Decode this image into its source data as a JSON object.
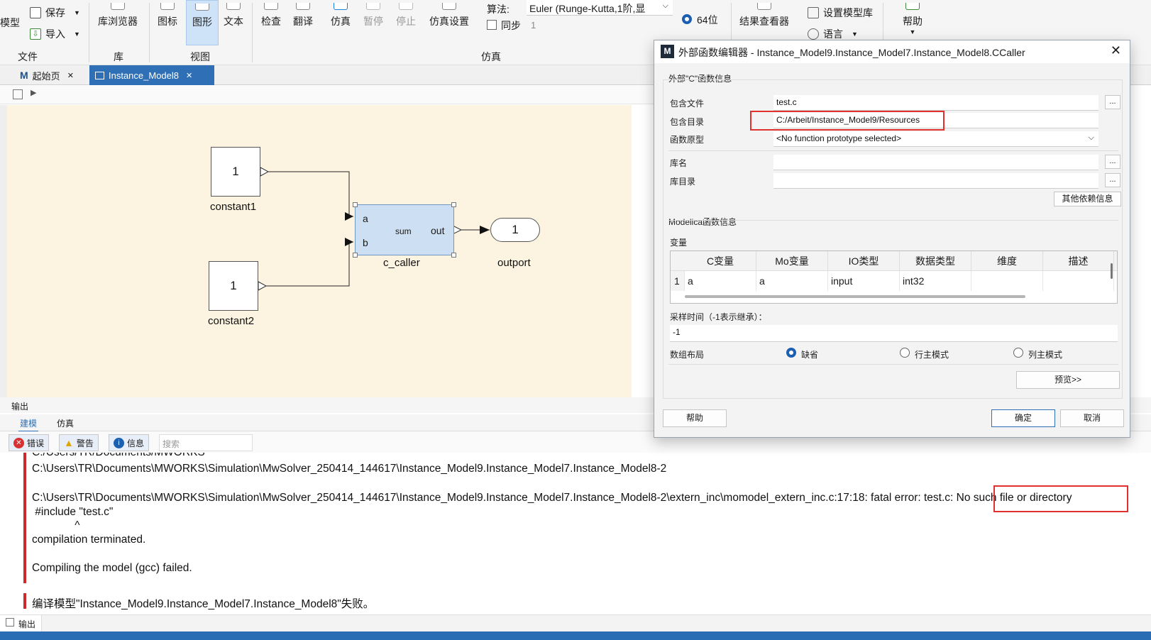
{
  "ribbon": {
    "model_label": "模型",
    "save_label": "保存",
    "import_label": "导入",
    "lib_browser_label": "库浏览器",
    "icon_label": "图标",
    "diagram_label": "图形",
    "text_label": "文本",
    "check_label": "检查",
    "translate_label": "翻译",
    "simulate_label": "仿真",
    "pause_label": "暂停",
    "stop_label": "停止",
    "sim_settings_label": "仿真设置",
    "algorithm_label": "算法:",
    "algorithm_value": "Euler (Runge-Kutta,1阶,显",
    "sync_label": "同步",
    "sync_value": "1",
    "bits_label": "64位",
    "result_viewer_label": "结果查看器",
    "set_model_lib_label": "设置模型库",
    "language_label": "语言",
    "help_label": "帮助",
    "groups": {
      "file": "文件",
      "library": "库",
      "view": "视图",
      "simulation": "仿真"
    }
  },
  "tabs": [
    {
      "label": "起始页"
    },
    {
      "label": "Instance_Model8"
    }
  ],
  "diagram": {
    "constant1": {
      "value": "1",
      "label": "constant1"
    },
    "constant2": {
      "value": "1",
      "label": "constant2"
    },
    "c_caller": {
      "label": "c_caller",
      "port_a": "a",
      "port_b": "b",
      "port_out": "out",
      "center": "sum"
    },
    "outport": {
      "value": "1",
      "label": "outport"
    }
  },
  "output": {
    "title": "输出",
    "tabs": [
      "建模",
      "仿真"
    ],
    "filters": {
      "error": "错误",
      "warning": "警告",
      "info": "信息"
    },
    "search_placeholder": "搜索",
    "lines": [
      "C:/Users/TR/Documents/MWORKS",
      "C:\\Users\\TR\\Documents\\MWORKS\\Simulation\\MwSolver_250414_144617\\Instance_Model9.Instance_Model7.Instance_Model8-2",
      "C:\\Users\\TR\\Documents\\MWORKS\\Simulation\\MwSolver_250414_144617\\Instance_Model9.Instance_Model7.Instance_Model8-2\\extern_inc\\momodel_extern_inc.c:17:18: fatal error: test.c: No such file or directory",
      " #include \"test.c\"",
      "              ^",
      "compilation terminated.",
      "Compiling the model (gcc) failed.",
      "编译模型\"Instance_Model9.Instance_Model7.Instance_Model8\"失败。"
    ],
    "bottom_tab": "输出"
  },
  "dialog": {
    "title": "外部函数编辑器 - Instance_Model9.Instance_Model7.Instance_Model8.CCaller",
    "section_c": "外部\"C\"函数信息",
    "include_file_label": "包含文件",
    "include_file_value": "test.c",
    "include_dir_label": "包含目录",
    "include_dir_value": "C:/Arbeit/Instance_Model9/Resources",
    "prototype_label": "函数原型",
    "prototype_value": "<No function prototype selected>",
    "lib_name_label": "库名",
    "lib_dir_label": "库目录",
    "other_deps_button": "其他依赖信息",
    "section_modelica": "Modelica函数信息",
    "variables_label": "变量",
    "table_headers": [
      "C变量",
      "Mo变量",
      "IO类型",
      "数据类型",
      "维度",
      "描述"
    ],
    "table_rows": [
      {
        "index": "1",
        "c_var": "a",
        "mo_var": "a",
        "io_type": "input",
        "data_type": "int32",
        "dim": "",
        "desc": ""
      }
    ],
    "sample_time_label": "采样时间（-1表示继承）：",
    "sample_time_value": "-1",
    "array_layout_label": "数组布局",
    "layout_options": [
      "缺省",
      "行主模式",
      "列主模式"
    ],
    "layout_selected": "缺省",
    "preview_button": "预览>>",
    "help_button": "帮助",
    "ok_button": "确定",
    "cancel_button": "取消",
    "dots": "..."
  },
  "colors": {
    "accent": "#2f6fb5",
    "highlight_red": "#e0312f",
    "canvas_bg": "#fdf3e1",
    "block_selected": "#cde0f3"
  }
}
